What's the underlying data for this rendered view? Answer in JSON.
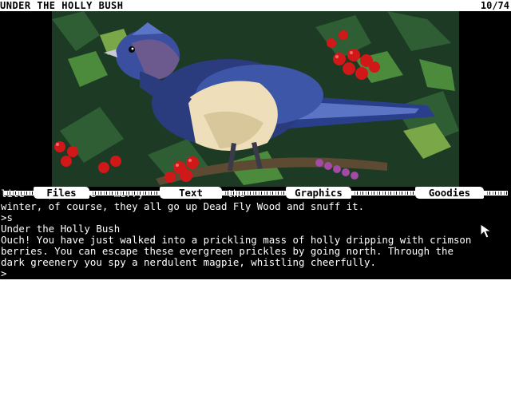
{
  "status": {
    "location": "UNDER THE HOLLY BUSH",
    "score": "10/74"
  },
  "scene": {
    "image": "magpie-in-holly-bush",
    "palette": {
      "bird_head": "#3b4fa0",
      "breast": "#f0e2c0",
      "berries": "#d01818",
      "leaves": "#1e4a2a"
    }
  },
  "menu": {
    "items": [
      "Files",
      "Text",
      "Graphics",
      "Goodies"
    ]
  },
  "text": {
    "lines": [
      "lite    port the   merry    tering    the",
      "winter, of course, they all go up Dead Fly Wood and snuff it.",
      ">s",
      "Under the Holly Bush",
      "Ouch! You have just walked into a prickling mass of holly dripping with crimson",
      "berries. You can escape these evergreen prickles by going north. Through the",
      "dark greenery you spy a nerdulent magpie, whistling cheerfully.",
      ">"
    ]
  }
}
